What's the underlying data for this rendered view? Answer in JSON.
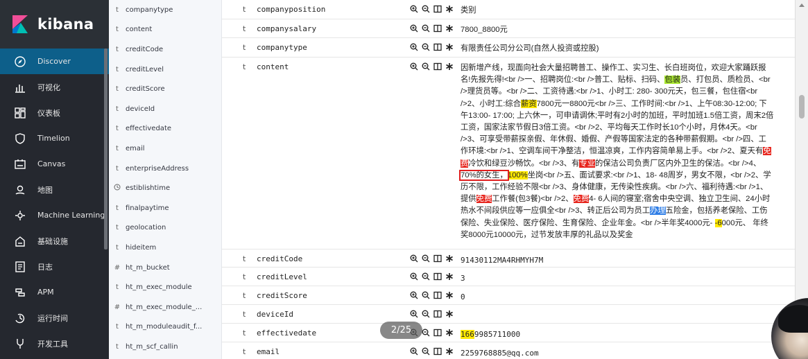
{
  "app": {
    "brand": "kibana",
    "colors": {
      "nav_bg": "#25282f",
      "nav_active": "#0d5f8a",
      "highlight_yellow": "#ffe800",
      "highlight_green": "#a8e62e",
      "highlight_red": "#e7251d",
      "highlight_blue": "#2f7ee6"
    }
  },
  "nav": {
    "items": [
      {
        "label": "Discover",
        "icon": "compass-icon",
        "active": true
      },
      {
        "label": "可视化",
        "icon": "bar-chart-icon"
      },
      {
        "label": "仪表板",
        "icon": "dashboard-icon"
      },
      {
        "label": "Timelion",
        "icon": "shield-icon"
      },
      {
        "label": "Canvas",
        "icon": "canvas-icon"
      },
      {
        "label": "地图",
        "icon": "map-pin-icon"
      },
      {
        "label": "Machine Learning",
        "icon": "ml-icon"
      },
      {
        "label": "基础设施",
        "icon": "infrastructure-icon"
      },
      {
        "label": "日志",
        "icon": "logs-icon"
      },
      {
        "label": "APM",
        "icon": "apm-icon"
      },
      {
        "label": "运行时间",
        "icon": "uptime-icon"
      },
      {
        "label": "开发工具",
        "icon": "wrench-icon"
      }
    ]
  },
  "field_list": [
    {
      "type": "t",
      "name": "companytype"
    },
    {
      "type": "t",
      "name": "content"
    },
    {
      "type": "t",
      "name": "creditCode"
    },
    {
      "type": "t",
      "name": "creditLevel"
    },
    {
      "type": "t",
      "name": "creditScore"
    },
    {
      "type": "t",
      "name": "deviceId"
    },
    {
      "type": "t",
      "name": "effectivedate"
    },
    {
      "type": "t",
      "name": "email"
    },
    {
      "type": "t",
      "name": "enterpriseAddress"
    },
    {
      "type": "clock",
      "name": "estiblishtime"
    },
    {
      "type": "t",
      "name": "finalpaytime"
    },
    {
      "type": "t",
      "name": "geolocation"
    },
    {
      "type": "t",
      "name": "hideitem"
    },
    {
      "type": "#",
      "name": "ht_m_bucket"
    },
    {
      "type": "t",
      "name": "ht_m_exec_module"
    },
    {
      "type": "#",
      "name": "ht_m_exec_module_..."
    },
    {
      "type": "t",
      "name": "ht_m_moduleaudit_f..."
    },
    {
      "type": "t",
      "name": "ht_m_scf_callin"
    }
  ],
  "doc": {
    "rows": [
      {
        "type": "t",
        "key": "companyposition",
        "value": "类别"
      },
      {
        "type": "t",
        "key": "companysalary",
        "value": "7800_8800元"
      },
      {
        "type": "t",
        "key": "companytype",
        "value": "有限责任公司分公司(自然人投资或控股)"
      },
      {
        "type": "t",
        "key": "content",
        "segments": [
          {
            "text": "因新增产线，现面向社会大量招聘普工、操作工、实习生、长白班岗位，欢迎大家踊跃报名!先报先得!<br />一、招聘岗位:<br />普工、贴标、扫码、"
          },
          {
            "text": "包装",
            "hl": "g"
          },
          {
            "text": "员、打包员、质检员、<br />理货员等。<br />二、工资待遇:<br />1、小时工: 280- 300元天，包三餐，包住宿<br />2、小时工:综合"
          },
          {
            "text": "薪资",
            "hl": "y"
          },
          {
            "text": "7800元一8800元<br />三、工作时间:<br />1、上午08:30-12:00; 下午13:00- 17:00; 上六休一，可申请调休;平时有2小时的加班，平时加班1.5倍工资，周末2倍工资，国家法家节假日3倍工资。<br />2、平均每天工作时长10个小时，月休4天。<br />3、可享受带薪探亲假、年休假、婚假、产假等国家法定的各种带薪假期。<br />四、工作环境:<br />1、空调车间干净整洁，恒温凉爽，工作内容简单易上手。<br />2、夏天有"
          },
          {
            "text": "免费",
            "hl": "r"
          },
          {
            "text": "冷饮和绿豆沙畅饮。<br />3、有"
          },
          {
            "text": "专业",
            "hl": "r"
          },
          {
            "text": "的保洁公司负责厂区内外卫生的保洁。<br />4、"
          },
          {
            "text": "70%的女生，",
            "hl": "box"
          },
          {
            "text": "100%",
            "hl": "y"
          },
          {
            "text": "坐岗<br />五、面试要求:<br />1、18- 48周岁，男女不限，<br />2、学历不限，工作经验不限<br />3、身体健康，无传染性疾病。<br />六、福利待遇:<br />1、提供"
          },
          {
            "text": "免费",
            "hl": "r"
          },
          {
            "text": "工作餐(包3餐)<br />2、"
          },
          {
            "text": "免费",
            "hl": "r"
          },
          {
            "text": "4- 6人间的寝室;宿舍中央空调、独立卫生间、24小时热水不间段供应等一应俱全<br />3、转正后公司为员工"
          },
          {
            "text": "办理",
            "hl": "b"
          },
          {
            "text": "五险金，包括养老保险、工伤保险、失业保险、医疗保险、生育保险、企业年金。<br />半年奖4000元- "
          },
          {
            "text": "-6",
            "hl": "y"
          },
          {
            "text": "000元、 年终奖8000元10000元，过节发放丰厚的礼品以及奖金"
          }
        ]
      },
      {
        "type": "t",
        "key": "creditCode",
        "value": "91430112MA4RHMYH7M"
      },
      {
        "type": "t",
        "key": "creditLevel",
        "value": "3"
      },
      {
        "type": "t",
        "key": "creditScore",
        "value": "0"
      },
      {
        "type": "t",
        "key": "deviceId",
        "value": ""
      },
      {
        "type": "t",
        "key": "effectivedate",
        "value_hl": "166",
        "value": "9985711000"
      },
      {
        "type": "t",
        "key": "email",
        "value": "2259768885@qq.com"
      }
    ],
    "action_icons": [
      "zoom-in-icon",
      "zoom-out-icon",
      "toggle-column-icon",
      "filter-exists-icon"
    ]
  },
  "pager": {
    "label": "2/25"
  }
}
